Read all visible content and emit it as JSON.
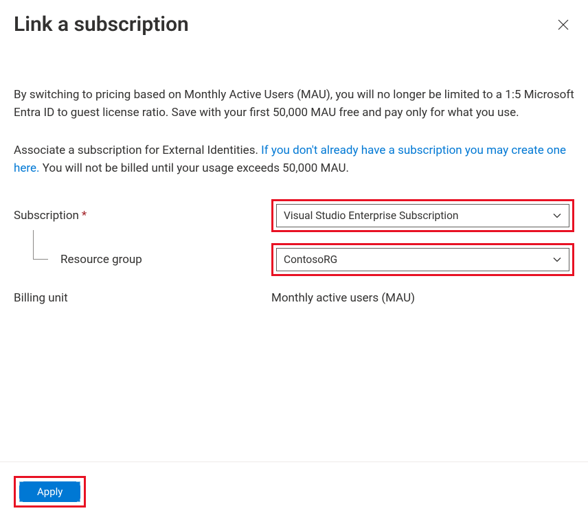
{
  "header": {
    "title": "Link a subscription"
  },
  "description": "By switching to pricing based on Monthly Active Users (MAU), you will no longer be limited to a 1:5 Microsoft Entra ID to guest license ratio. Save with your first 50,000 MAU free and pay only for what you use.",
  "associate": {
    "prefix": "Associate a subscription for External Identities. ",
    "link_text": "If you don't already have a subscription you may create one here.",
    "suffix": " You will not be billed until your usage exceeds 50,000 MAU."
  },
  "form": {
    "subscription": {
      "label": "Subscription",
      "required_mark": "*",
      "value": "Visual Studio Enterprise Subscription"
    },
    "resource_group": {
      "label": "Resource group",
      "value": "ContosoRG"
    },
    "billing_unit": {
      "label": "Billing unit",
      "value": "Monthly active users (MAU)"
    }
  },
  "footer": {
    "apply_label": "Apply"
  }
}
